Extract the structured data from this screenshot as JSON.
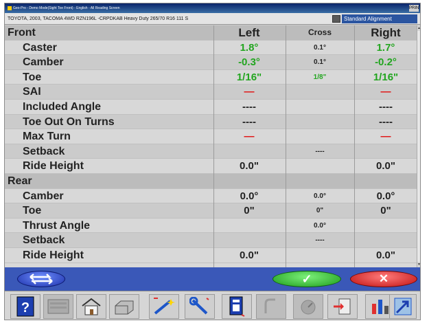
{
  "window": {
    "title": "Geo-Pro - Demo Mode(Sight Toe Front) - English - All Reading Screen",
    "close_label": "PRINT"
  },
  "vehicle": {
    "description": "TOYOTA, 2003, TACOMA 4WD RZN196L -CRPDKAB Heavy Duty 265/70 R16 111 S",
    "mode_label": "Standard Alignment"
  },
  "table": {
    "header": {
      "section": "Front",
      "left": "Left",
      "cross": "Cross",
      "right": "Right"
    },
    "front_rows": [
      {
        "label": "Caster",
        "left": "1.8°",
        "cross": "0.1°",
        "right": "1.7°",
        "left_color": "green",
        "cross_color": "",
        "right_color": "green"
      },
      {
        "label": "Camber",
        "left": "-0.3°",
        "cross": "0.1°",
        "right": "-0.2°",
        "left_color": "green",
        "cross_color": "",
        "right_color": "green"
      },
      {
        "label": "Toe",
        "left": "1/16\"",
        "cross": "1/8\"",
        "right": "1/16\"",
        "left_color": "green",
        "cross_color": "green",
        "right_color": "green"
      },
      {
        "label": "SAI",
        "left": "—",
        "cross": "",
        "right": "—",
        "left_color": "red",
        "cross_color": "",
        "right_color": "red"
      },
      {
        "label": "Included Angle",
        "left": "----",
        "cross": "",
        "right": "----",
        "left_color": "",
        "cross_color": "",
        "right_color": ""
      },
      {
        "label": "Toe Out On Turns",
        "left": "----",
        "cross": "",
        "right": "----",
        "left_color": "",
        "cross_color": "",
        "right_color": ""
      },
      {
        "label": "Max Turn",
        "left": "—",
        "cross": "",
        "right": "—",
        "left_color": "red",
        "cross_color": "",
        "right_color": "red"
      },
      {
        "label": "Setback",
        "left": "",
        "cross": "----",
        "right": "",
        "left_color": "",
        "cross_color": "",
        "right_color": ""
      },
      {
        "label": "Ride Height",
        "left": "0.0\"",
        "cross": "",
        "right": "0.0\"",
        "left_color": "",
        "cross_color": "",
        "right_color": ""
      }
    ],
    "rear_section": "Rear",
    "rear_rows": [
      {
        "label": "Camber",
        "left": "0.0°",
        "cross": "0.0°",
        "right": "0.0°",
        "left_color": "",
        "cross_color": "",
        "right_color": ""
      },
      {
        "label": "Toe",
        "left": "0\"",
        "cross": "0\"",
        "right": "0\"",
        "left_color": "",
        "cross_color": "",
        "right_color": ""
      },
      {
        "label": "Thrust Angle",
        "left": "",
        "cross": "0.0°",
        "right": "",
        "left_color": "",
        "cross_color": "",
        "right_color": ""
      },
      {
        "label": "Setback",
        "left": "",
        "cross": "----",
        "right": "",
        "left_color": "",
        "cross_color": "",
        "right_color": ""
      },
      {
        "label": "Ride Height",
        "left": "0.0\"",
        "cross": "",
        "right": "0.0\"",
        "left_color": "",
        "cross_color": "",
        "right_color": ""
      }
    ]
  },
  "actions": {
    "ok_label": "✓",
    "cancel_label": "✕"
  },
  "colors": {
    "in_spec": "#22a51f",
    "out_of_spec": "#e01616",
    "action_bar": "#3a58b8"
  },
  "toolbar": {
    "icons": [
      "help-icon",
      "keyboard-icon",
      "home-icon",
      "print-icon",
      "wand-icon",
      "wrench-icon",
      "document-icon",
      "disabled-tool-icon",
      "gauge-icon",
      "document-arrow-icon",
      "chart-icon",
      "exit-icon"
    ]
  }
}
